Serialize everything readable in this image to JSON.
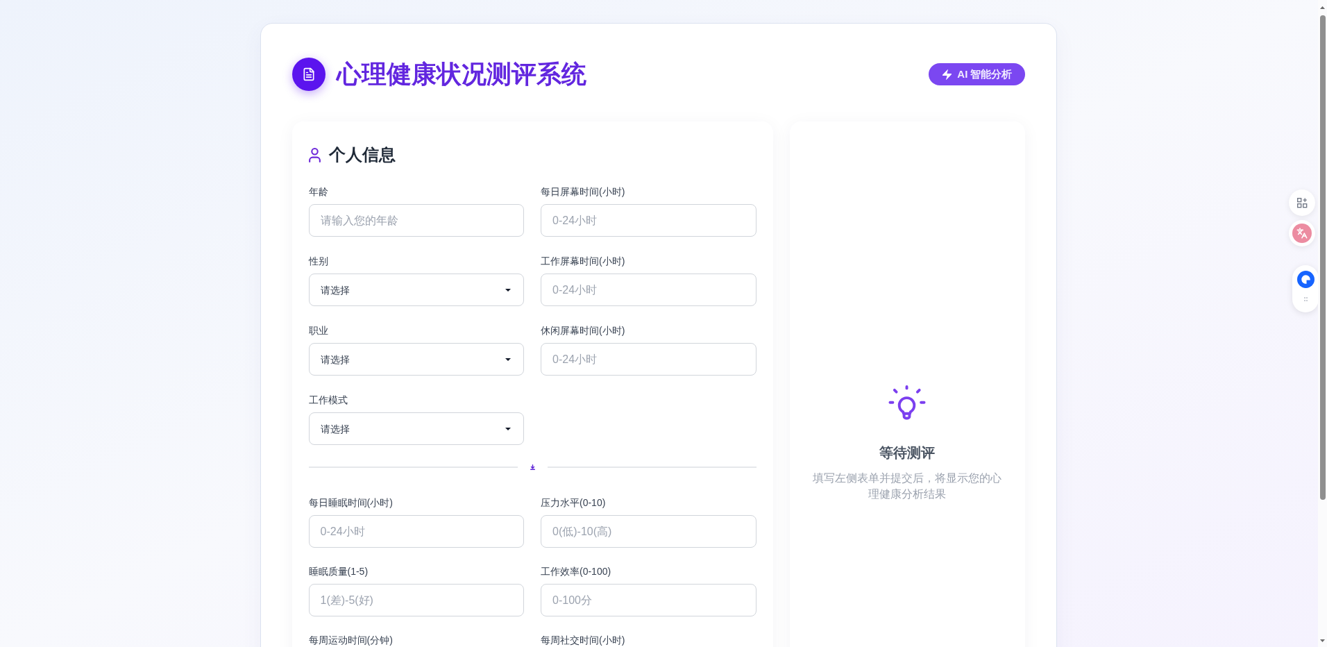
{
  "header": {
    "title": "心理健康状况测评系统",
    "badge": "AI 智能分析"
  },
  "form": {
    "section_title": "个人信息",
    "groups": [
      {
        "fields": [
          {
            "label": "年龄",
            "control": {
              "kind": "input",
              "placeholder": "请输入您的年龄"
            }
          },
          {
            "label": "每日屏幕时间(小时)",
            "control": {
              "kind": "input",
              "placeholder": "0-24小时"
            }
          },
          {
            "label": "性别",
            "control": {
              "kind": "select",
              "value": "请选择"
            }
          },
          {
            "label": "工作屏幕时间(小时)",
            "control": {
              "kind": "input",
              "placeholder": "0-24小时"
            }
          },
          {
            "label": "职业",
            "control": {
              "kind": "select",
              "value": "请选择"
            }
          },
          {
            "label": "休闲屏幕时间(小时)",
            "control": {
              "kind": "input",
              "placeholder": "0-24小时"
            }
          },
          {
            "label": "工作模式",
            "control": {
              "kind": "select",
              "value": "请选择"
            }
          }
        ]
      },
      {
        "fields": [
          {
            "label": "每日睡眠时间(小时)",
            "control": {
              "kind": "input",
              "placeholder": "0-24小时"
            }
          },
          {
            "label": "压力水平(0-10)",
            "control": {
              "kind": "input",
              "placeholder": "0(低)-10(高)"
            }
          },
          {
            "label": "睡眠质量(1-5)",
            "control": {
              "kind": "input",
              "placeholder": "1(差)-5(好)"
            }
          },
          {
            "label": "工作效率(0-100)",
            "control": {
              "kind": "input",
              "placeholder": "0-100分"
            }
          },
          {
            "label": "每周运动时间(分钟)"
          },
          {
            "label": "每周社交时间(小时)"
          }
        ]
      }
    ]
  },
  "result_panel": {
    "title": "等待测评",
    "message": "填写左侧表单并提交后，将显示您的心理健康分析结果"
  }
}
